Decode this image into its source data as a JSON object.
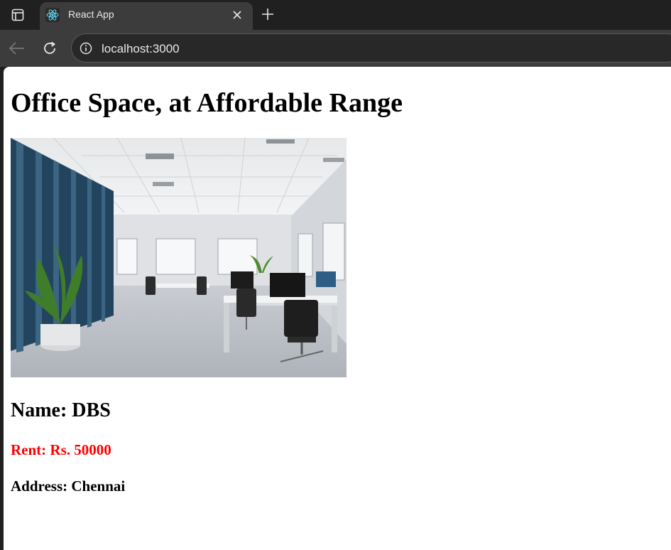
{
  "browser": {
    "tab": {
      "title": "React App",
      "favicon": "react-logo-icon"
    },
    "address_bar": {
      "url": "localhost:3000"
    },
    "icons": {
      "tab_actions": "tab-actions-icon",
      "close": "close-icon",
      "new_tab": "plus-icon",
      "back": "back-arrow-icon",
      "reload": "reload-icon",
      "site_info": "info-icon"
    }
  },
  "page": {
    "heading": "Office Space, at Affordable Range",
    "office": {
      "image_alt": "office interior",
      "name_label": "Name: DBS",
      "rent_label": "Rent: Rs. 50000",
      "address_label": "Address: Chennai"
    },
    "colors": {
      "rent_text": "#ff0000",
      "react_logo": "#61dafb"
    }
  }
}
